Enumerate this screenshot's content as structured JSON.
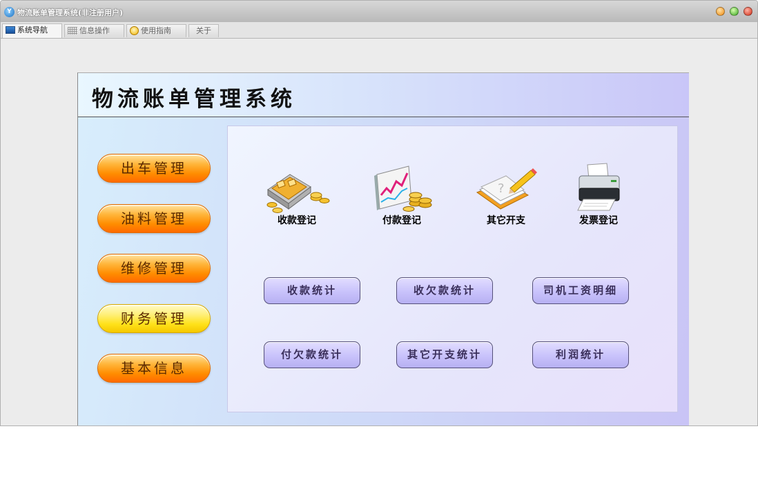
{
  "window": {
    "title": "物流账单管理系统(非注册用户)",
    "app_icon": "app-logo-icon"
  },
  "tabs": [
    {
      "label": "系统导航",
      "icon": "monitor-icon",
      "active": true
    },
    {
      "label": "信息操作",
      "icon": "grid-icon",
      "active": false
    },
    {
      "label": "使用指南",
      "icon": "lightbulb-icon",
      "active": false
    },
    {
      "label": "关于",
      "icon": "",
      "active": false
    }
  ],
  "header": {
    "title": "物流账单管理系统"
  },
  "sidebar": {
    "items": [
      {
        "label": "出车管理",
        "style": "orange"
      },
      {
        "label": "油料管理",
        "style": "orange"
      },
      {
        "label": "维修管理",
        "style": "orange"
      },
      {
        "label": "财务管理",
        "style": "yellow"
      },
      {
        "label": "基本信息",
        "style": "orange"
      }
    ]
  },
  "icons": [
    {
      "label": "收款登记",
      "icon": "cash-register-coins-icon"
    },
    {
      "label": "付款登记",
      "icon": "stock-chart-coins-icon"
    },
    {
      "label": "其它开支",
      "icon": "notebook-pencil-icon"
    },
    {
      "label": "发票登记",
      "icon": "printer-icon"
    }
  ],
  "stats": {
    "row1": [
      "收款统计",
      "收欠款统计",
      "司机工资明细"
    ],
    "row2": [
      "付欠款统计",
      "其它开支统计",
      "利润统计"
    ]
  },
  "colors": {
    "accent_orange": "#ff8c00",
    "accent_yellow": "#ffe21a",
    "stat_button": "#c8c2fb"
  }
}
